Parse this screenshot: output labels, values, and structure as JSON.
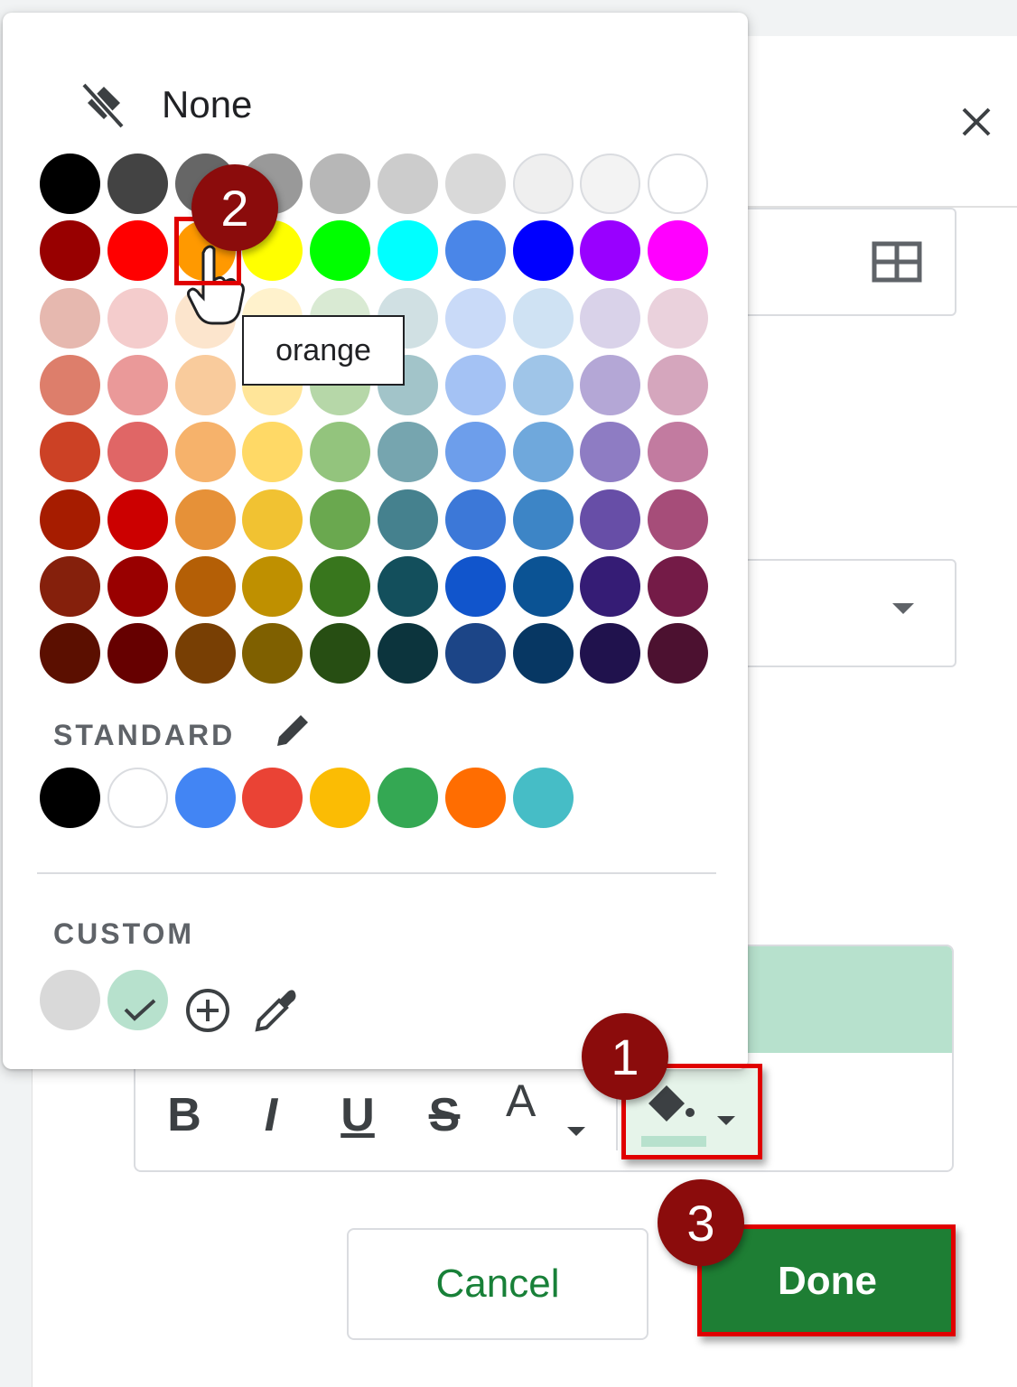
{
  "picker": {
    "none_label": "None",
    "grid_colors": [
      [
        "#000000",
        "#434343",
        "#666666",
        "#999999",
        "#b7b7b7",
        "#cccccc",
        "#d9d9d9",
        "#efefef",
        "#f3f3f3",
        "#ffffff"
      ],
      [
        "#980000",
        "#ff0000",
        "#ff9900",
        "#ffff00",
        "#00ff00",
        "#00ffff",
        "#4a86e8",
        "#0000ff",
        "#9900ff",
        "#ff00ff"
      ],
      [
        "#e6b8af",
        "#f4cccc",
        "#fce5cd",
        "#fff2cc",
        "#d9ead3",
        "#d0e0e3",
        "#c9daf8",
        "#cfe2f3",
        "#d9d2e9",
        "#ead1dc"
      ],
      [
        "#dd7e6b",
        "#ea9999",
        "#f9cb9c",
        "#ffe599",
        "#b6d7a8",
        "#a2c4c9",
        "#a4c2f4",
        "#9fc5e8",
        "#b4a7d6",
        "#d5a6bd"
      ],
      [
        "#cc4125",
        "#e06666",
        "#f6b26b",
        "#ffd966",
        "#93c47d",
        "#76a5af",
        "#6d9eeb",
        "#6fa8dc",
        "#8e7cc3",
        "#c27ba0"
      ],
      [
        "#a61c00",
        "#cc0000",
        "#e69138",
        "#f1c232",
        "#6aa84f",
        "#45818e",
        "#3c78d8",
        "#3d85c6",
        "#674ea7",
        "#a64d79"
      ],
      [
        "#85200c",
        "#990000",
        "#b45f06",
        "#bf9000",
        "#38761d",
        "#134f5c",
        "#1155cc",
        "#0b5394",
        "#351c75",
        "#741b47"
      ],
      [
        "#5b0f00",
        "#660000",
        "#783f04",
        "#7f6000",
        "#274e13",
        "#0c343d",
        "#1c4587",
        "#073763",
        "#20124d",
        "#4c1130"
      ]
    ],
    "standard_label": "STANDARD",
    "standard_colors": [
      "#000000",
      "#ffffff",
      "#4285f4",
      "#ea4335",
      "#fbbc04",
      "#34a853",
      "#ff6d01",
      "#46bdc6"
    ],
    "custom_label": "CUSTOM",
    "custom_colors": [
      "#d9d9d9",
      "#b7e1cd"
    ],
    "hovered_tooltip": "orange"
  },
  "editor": {
    "fill_color": "#b7e1cd",
    "toolbar": {
      "bold": "B",
      "italic": "I",
      "underline": "U",
      "strike": "S",
      "text_color": "A"
    }
  },
  "buttons": {
    "cancel": "Cancel",
    "done": "Done"
  },
  "steps": [
    "1",
    "2",
    "3"
  ],
  "colors": {
    "highlight": "#e00000",
    "badge": "#8b0c0c",
    "done_bg": "#1e7e34"
  }
}
